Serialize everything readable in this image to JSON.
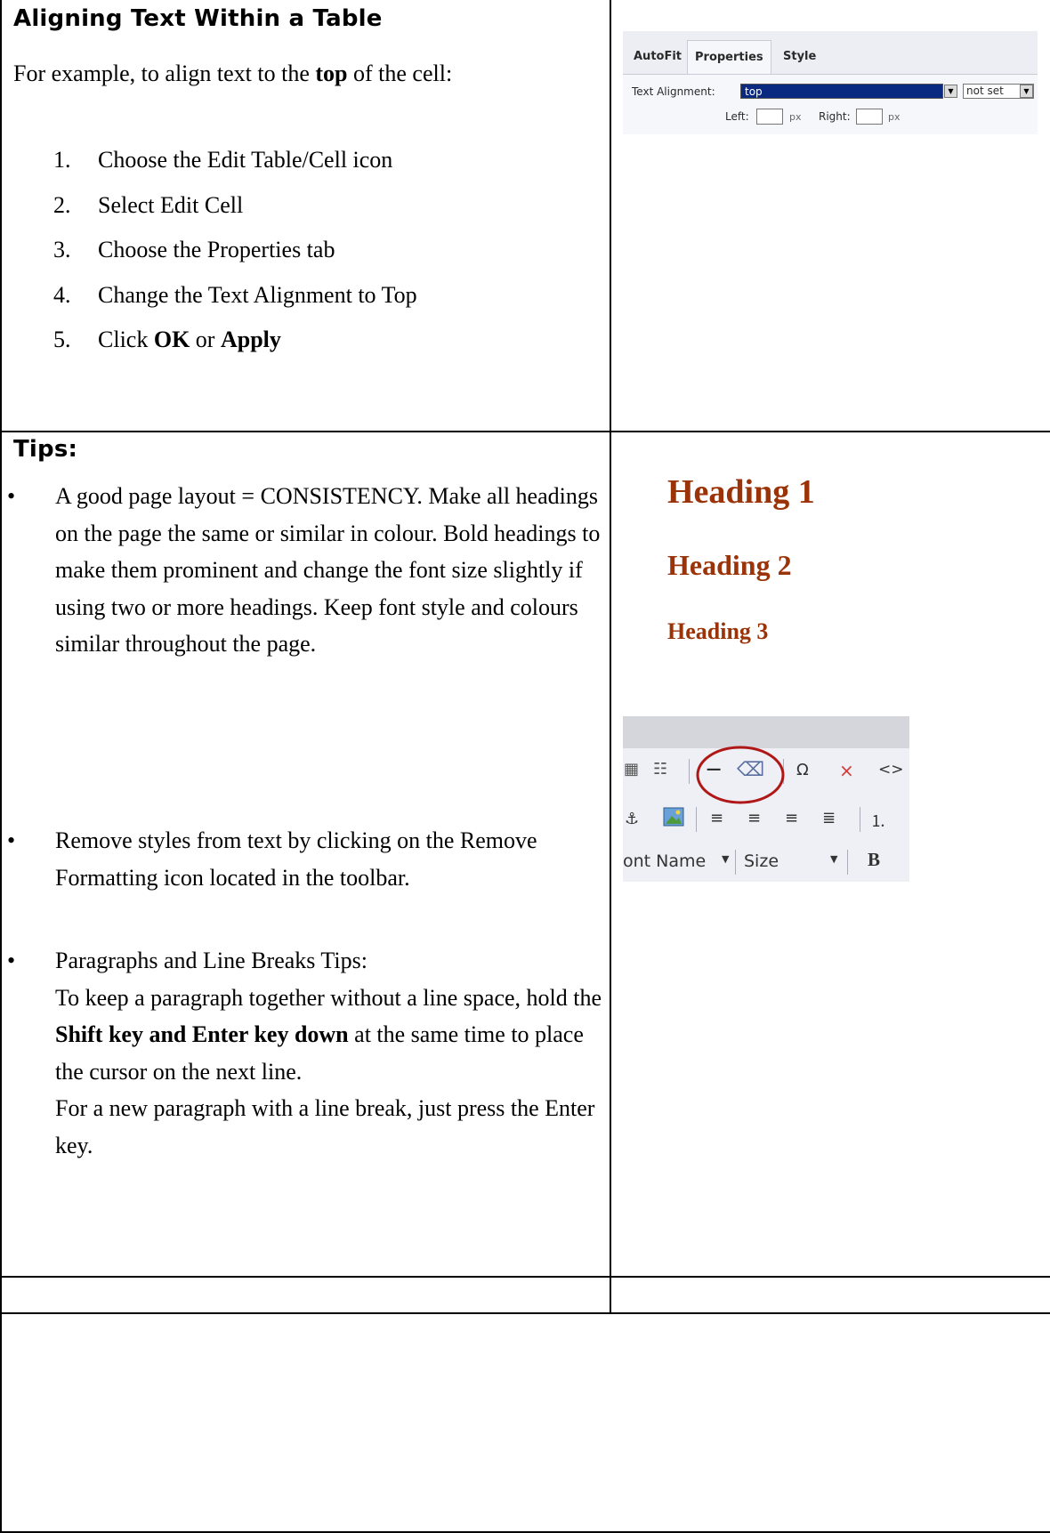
{
  "section1": {
    "title": "Aligning Text Within a Table",
    "intro_before": "For example, to align text to the ",
    "intro_bold": "top",
    "intro_after": " of the cell:",
    "steps": [
      {
        "num": "1.",
        "text": "Choose the Edit Table/Cell icon"
      },
      {
        "num": "2.",
        "text": "Select Edit Cell"
      },
      {
        "num": "3.",
        "text": "Choose the Properties tab"
      },
      {
        "num": "4.",
        "text": "Change the Text Alignment to Top"
      }
    ],
    "step5": {
      "num": "5.",
      "before": "Click ",
      "bold1": "OK",
      "mid": " or ",
      "bold2": "Apply"
    }
  },
  "props_panel": {
    "tabs": [
      "AutoFit",
      "Properties",
      "Style"
    ],
    "text_alignment_label": "Text Alignment:",
    "alignment_value": "top",
    "second_value": "not set",
    "left_label": "Left:",
    "right_label": "Right:",
    "unit_left": "px",
    "unit_right": "px"
  },
  "section2": {
    "title": "Tips:",
    "bullet1": "A good page layout = CONSISTENCY. Make all headings on the page the same or similar in colour. Bold headings to make them prominent and change the font size slightly if using two or more headings. Keep font style and colours similar throughout the page.",
    "bullet2": "Remove styles from text by clicking on the Remove Formatting icon located in the toolbar.",
    "bullet3_line1": "Paragraphs and Line Breaks Tips:",
    "bullet3_a": "To keep a paragraph together without a line space, hold the ",
    "bullet3_bold": "Shift key and Enter key down",
    "bullet3_b": " at the same time to place the cursor on the next line.",
    "bullet3_c": "For a new paragraph with a line break, just press the Enter key."
  },
  "headings": {
    "h1": "Heading 1",
    "h2": "Heading 2",
    "h3": "Heading 3",
    "color": "#9b3308"
  },
  "toolbar_shot": {
    "font_name_label": "ont Name",
    "size_label": "Size",
    "bold_glyph": "B",
    "highlight_color": "#b01818"
  }
}
